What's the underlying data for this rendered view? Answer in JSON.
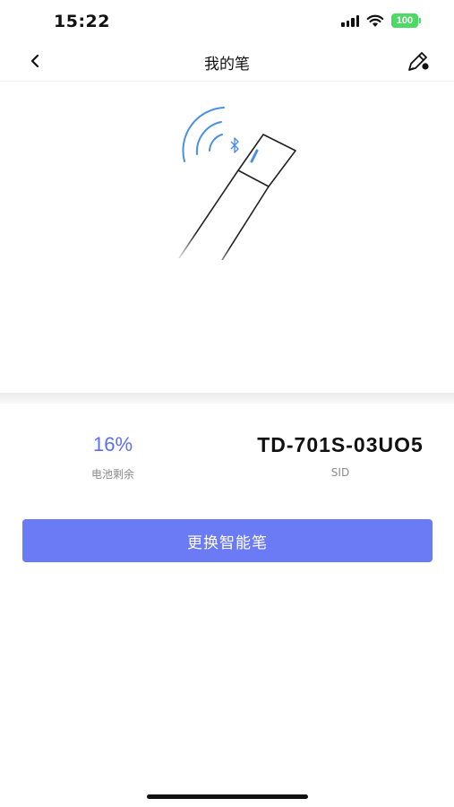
{
  "status_bar": {
    "time": "15:22",
    "battery_level": "100"
  },
  "nav": {
    "title": "我的笔"
  },
  "stats": {
    "battery": {
      "value": "16%",
      "label": "电池剩余"
    },
    "sid": {
      "value": "TD-701S-03UO5",
      "label": "SID"
    }
  },
  "actions": {
    "replace_pen_label": "更换智能笔"
  },
  "colors": {
    "accent": "#6b7af5",
    "battery_text": "#5b6ef5",
    "signal_waves": "#4a90e2"
  }
}
